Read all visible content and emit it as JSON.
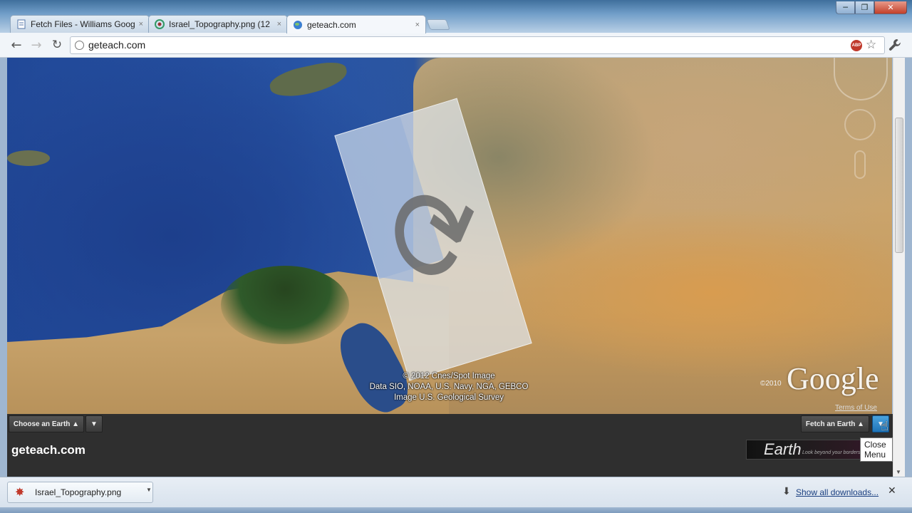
{
  "window": {
    "minimize": "─",
    "maximize": "❐",
    "close": "✕"
  },
  "tabs": [
    {
      "label": "Fetch Files - Williams Goog",
      "close": "×"
    },
    {
      "label": "Israel_Topography.png (12",
      "close": "×"
    },
    {
      "label": "geteach.com",
      "close": "×"
    }
  ],
  "toolbar": {
    "back": "←",
    "forward": "→",
    "reload": "↻",
    "url": "geteach.com",
    "abp": "ABP",
    "star": "☆"
  },
  "map": {
    "loading_glyph": "⟳",
    "attribution": [
      "© 2012 Cnes/Spot Image",
      "Data SIO, NOAA, U.S. Navy, NGA, GEBCO",
      "Image U.S. Geological Survey"
    ],
    "google_logo": "Google",
    "google_year": "©2010",
    "terms": "Terms of Use"
  },
  "bottombar": {
    "choose_earth": "Choose an Earth ▲",
    "choose_arrow": "▼",
    "fetch_earth": "Fetch an Earth ▲",
    "fetch_arrow": "▼",
    "site_title": "geteach.com",
    "banner_text": "Earth",
    "banner_tag": "Look beyond your borders",
    "tooltip": "Close Menu"
  },
  "downloads": {
    "file_name": "Israel_Topography.png",
    "menu_arrow": "▼",
    "show_all": "Show all downloads...",
    "close": "✕"
  },
  "colors": {
    "accent": "#1f74b8",
    "link": "#1a3f80"
  }
}
